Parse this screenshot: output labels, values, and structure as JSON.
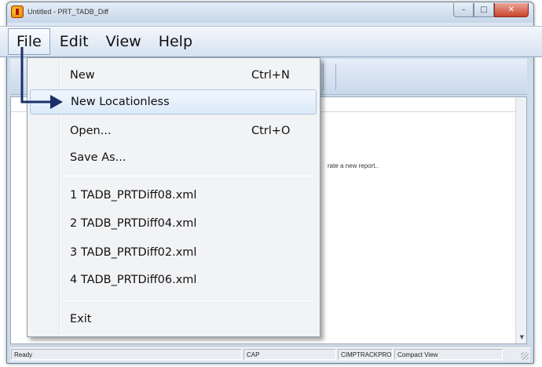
{
  "window": {
    "title": "Untitled - PRT_TADB_Diff",
    "caption_buttons": {
      "minimize": "–",
      "maximize": "□",
      "close": "✕"
    }
  },
  "menubar": {
    "items": [
      "File",
      "Edit",
      "View",
      "Help"
    ]
  },
  "file_menu": {
    "items": [
      {
        "label": "New",
        "shortcut": "Ctrl+N"
      },
      {
        "label": "New Locationless",
        "shortcut": ""
      },
      {
        "label": "Open...",
        "shortcut": "Ctrl+O"
      },
      {
        "label": "Save As...",
        "shortcut": ""
      },
      {
        "label": "1 TADB_PRTDiff08.xml",
        "shortcut": ""
      },
      {
        "label": "2 TADB_PRTDiff04.xml",
        "shortcut": ""
      },
      {
        "label": "3 TADB_PRTDiff02.xml",
        "shortcut": ""
      },
      {
        "label": "4 TADB_PRTDiff06.xml",
        "shortcut": ""
      },
      {
        "label": "Exit",
        "shortcut": ""
      }
    ]
  },
  "client": {
    "hint_fragment": "rate a new report.."
  },
  "statusbar": {
    "ready": "Ready",
    "cap": "CAP",
    "product": "CIMPTRACKPRO",
    "view": "Compact View"
  },
  "colors": {
    "annotation_arrow": "#1b2f6b",
    "highlight": "#dbe9f8"
  },
  "icons": {
    "app": "app-icon",
    "annotation": "arrow-icon",
    "grip": "resize-grip-icon"
  }
}
